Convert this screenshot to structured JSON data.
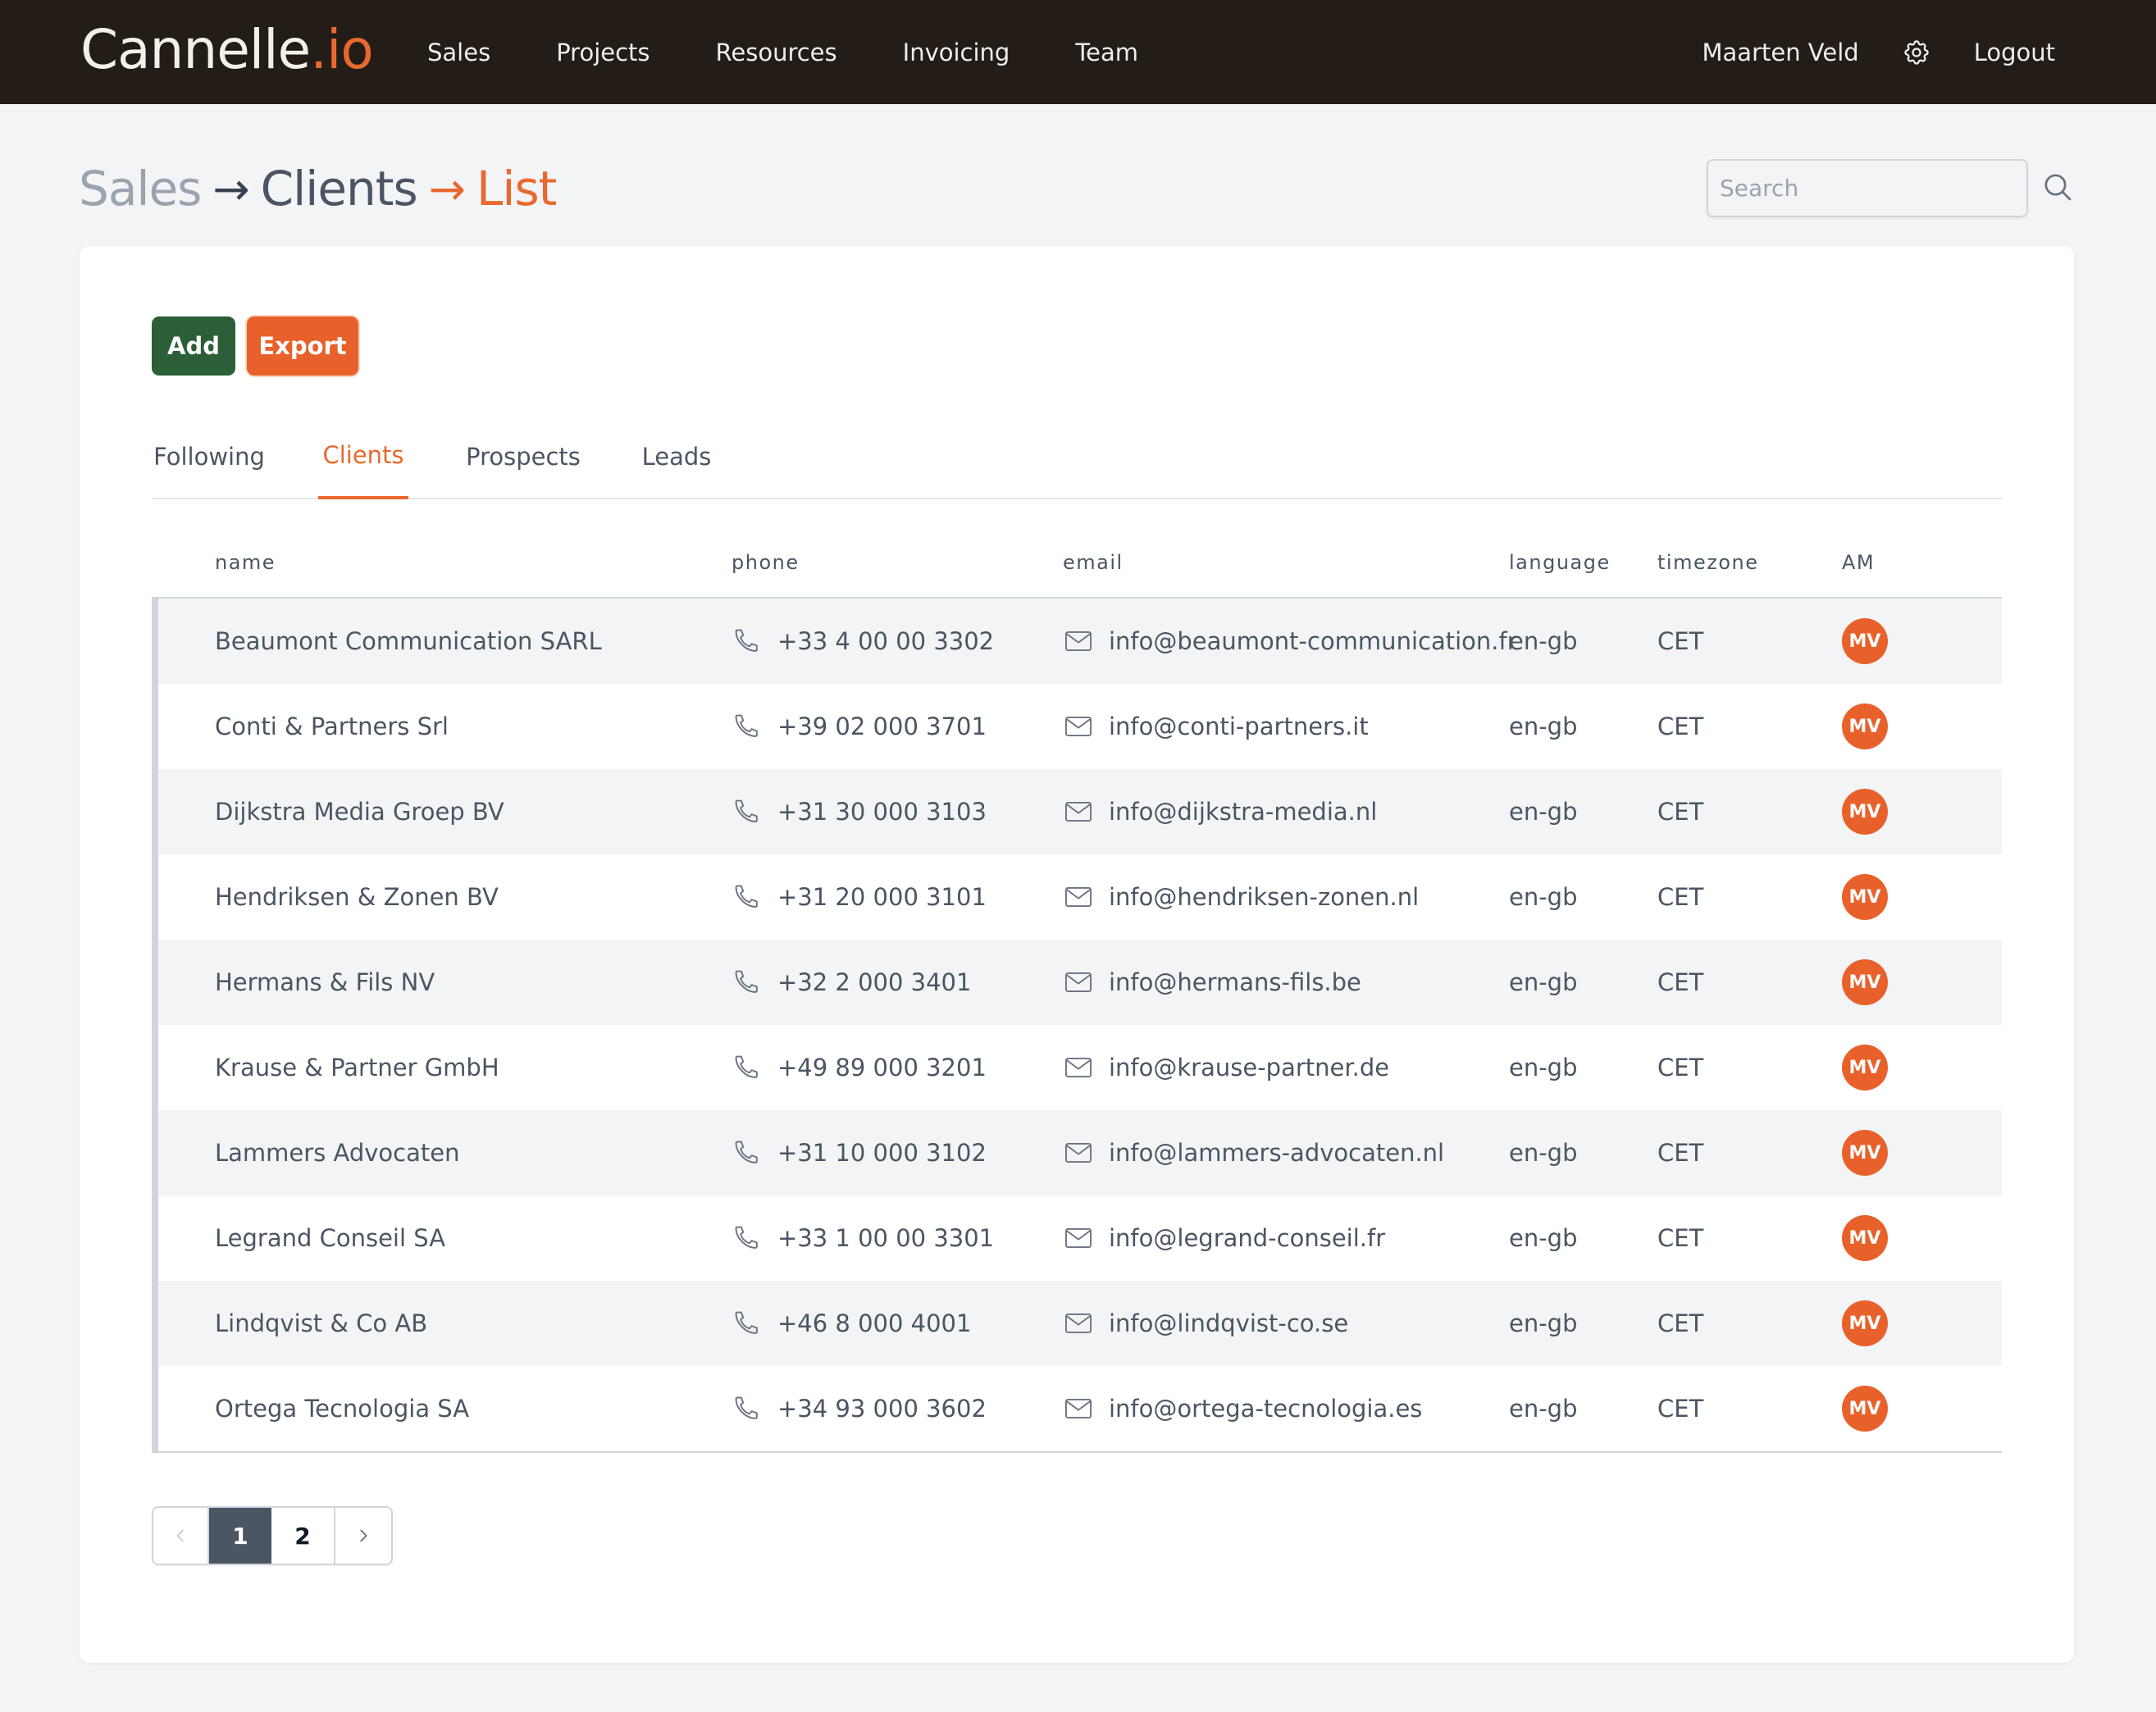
{
  "app": {
    "logo_main": "Cannelle",
    "logo_accent": ".io",
    "nav": [
      "Sales",
      "Projects",
      "Resources",
      "Invoicing",
      "Team"
    ],
    "user_name": "Maarten Veld",
    "logout_label": "Logout",
    "accent_color": "#e8692f"
  },
  "breadcrumb": {
    "level1": "Sales",
    "level2": "Clients",
    "level3": "List",
    "separator": "→"
  },
  "search": {
    "placeholder": "Search"
  },
  "toolbar": {
    "add_label": "Add",
    "export_label": "Export"
  },
  "tabs": [
    {
      "label": "Following",
      "active": false
    },
    {
      "label": "Clients",
      "active": true
    },
    {
      "label": "Prospects",
      "active": false
    },
    {
      "label": "Leads",
      "active": false
    }
  ],
  "table": {
    "columns": [
      "name",
      "phone",
      "email",
      "language",
      "timezone",
      "AM"
    ],
    "rows": [
      {
        "name": "Beaumont Communication SARL",
        "phone": "+33 4 00 00 3302",
        "email": "info@beaumont-communication.fr",
        "language": "en-gb",
        "timezone": "CET",
        "am": "MV"
      },
      {
        "name": "Conti & Partners Srl",
        "phone": "+39 02 000 3701",
        "email": "info@conti-partners.it",
        "language": "en-gb",
        "timezone": "CET",
        "am": "MV"
      },
      {
        "name": "Dijkstra Media Groep BV",
        "phone": "+31 30 000 3103",
        "email": "info@dijkstra-media.nl",
        "language": "en-gb",
        "timezone": "CET",
        "am": "MV"
      },
      {
        "name": "Hendriksen & Zonen BV",
        "phone": "+31 20 000 3101",
        "email": "info@hendriksen-zonen.nl",
        "language": "en-gb",
        "timezone": "CET",
        "am": "MV"
      },
      {
        "name": "Hermans & Fils NV",
        "phone": "+32 2 000 3401",
        "email": "info@hermans-fils.be",
        "language": "en-gb",
        "timezone": "CET",
        "am": "MV"
      },
      {
        "name": "Krause & Partner GmbH",
        "phone": "+49 89 000 3201",
        "email": "info@krause-partner.de",
        "language": "en-gb",
        "timezone": "CET",
        "am": "MV"
      },
      {
        "name": "Lammers Advocaten",
        "phone": "+31 10 000 3102",
        "email": "info@lammers-advocaten.nl",
        "language": "en-gb",
        "timezone": "CET",
        "am": "MV"
      },
      {
        "name": "Legrand Conseil SA",
        "phone": "+33 1 00 00 3301",
        "email": "info@legrand-conseil.fr",
        "language": "en-gb",
        "timezone": "CET",
        "am": "MV"
      },
      {
        "name": "Lindqvist & Co AB",
        "phone": "+46 8 000 4001",
        "email": "info@lindqvist-co.se",
        "language": "en-gb",
        "timezone": "CET",
        "am": "MV"
      },
      {
        "name": "Ortega Tecnologia SA",
        "phone": "+34 93 000 3602",
        "email": "info@ortega-tecnologia.es",
        "language": "en-gb",
        "timezone": "CET",
        "am": "MV"
      }
    ]
  },
  "pagination": {
    "pages": [
      "1",
      "2"
    ],
    "current": "1"
  }
}
